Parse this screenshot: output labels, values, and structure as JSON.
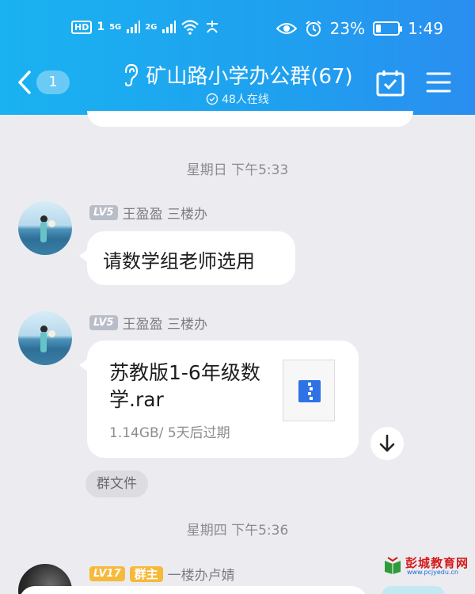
{
  "status_bar": {
    "hd_label": "HD",
    "sim1": "1",
    "net1": "5G",
    "net2": "2G",
    "battery_text": "23%",
    "battery_level": 0.23,
    "time": "1:49"
  },
  "header": {
    "back_count": "1",
    "title": "矿山路小学办公群(67)",
    "online_text": "48人在线"
  },
  "messages": {
    "sep1": "星期日  下午5:33",
    "msg1": {
      "level": "LV5",
      "sender": "王盈盈 三楼办",
      "text": "请数学组老师选用"
    },
    "msg2": {
      "level": "LV5",
      "sender": "王盈盈 三楼办",
      "file_name": "苏教版1-6年级数学.rar",
      "file_meta": "1.14GB/ 5天后过期"
    },
    "group_files_label": "群文件",
    "sep2": "星期四  下午5:36",
    "msg3": {
      "level": "LV17",
      "role": "群主",
      "sender": "一楼办卢婧"
    }
  },
  "watermark": {
    "title": "彭城教育网",
    "url": "www.pcjyedu.cn"
  },
  "colors": {
    "header_start": "#1ab2f0",
    "header_end": "#2a8ef0",
    "chat_bg": "#ececf0",
    "file_icon": "#2f72e6",
    "owner_badge": "#f6b93b"
  }
}
